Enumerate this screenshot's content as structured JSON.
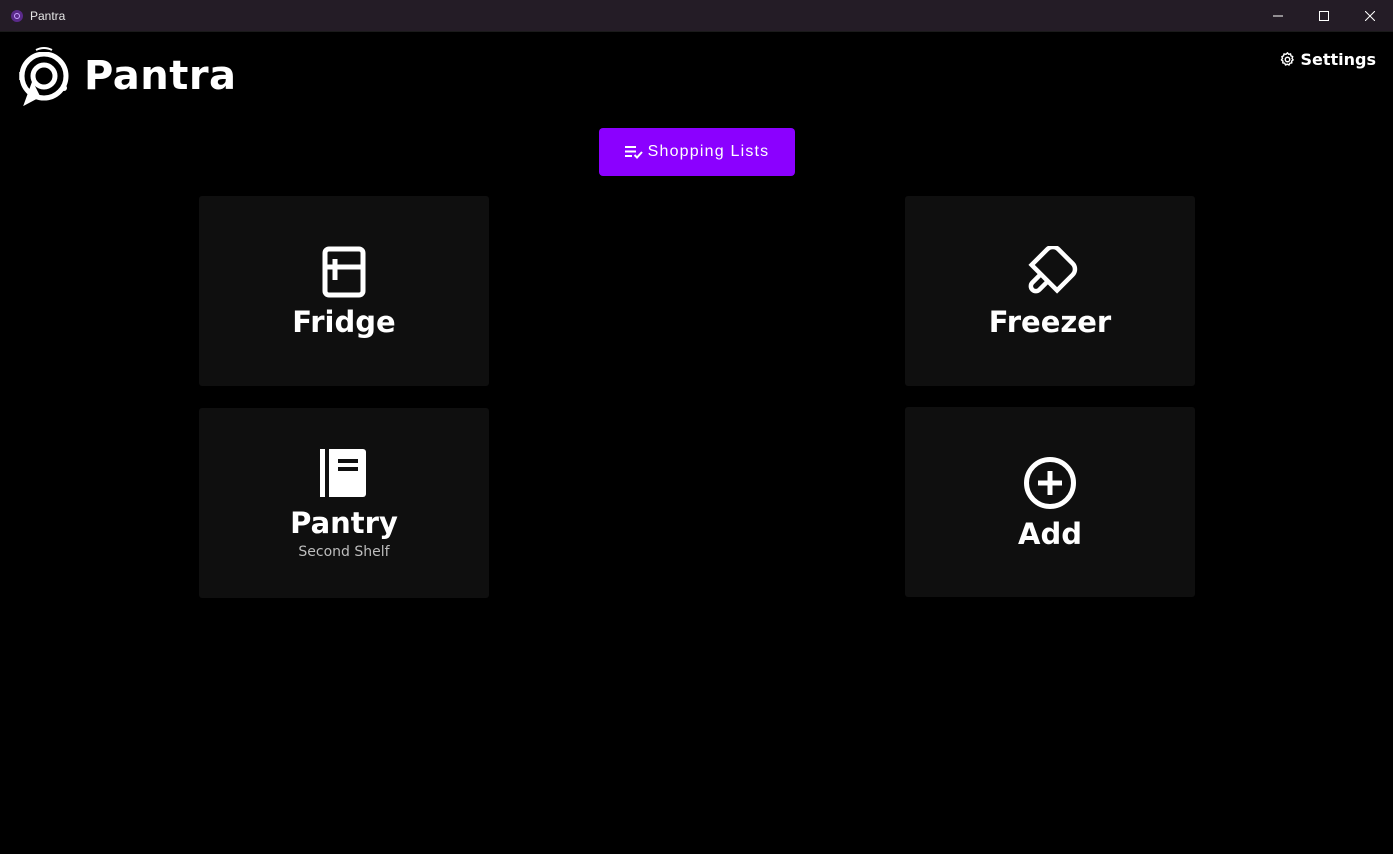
{
  "window": {
    "title": "Pantra",
    "controls": {
      "minimize": "minimize-icon",
      "maximize": "maximize-icon",
      "close": "close-icon"
    }
  },
  "header": {
    "logo_text": "Pantra",
    "settings_label": "Settings"
  },
  "shopping": {
    "label": "Shopping Lists"
  },
  "tiles": [
    {
      "label": "Fridge",
      "icon": "fridge-icon",
      "subtitle": ""
    },
    {
      "label": "Freezer",
      "icon": "popsicle-icon",
      "subtitle": ""
    },
    {
      "label": "Pantry",
      "icon": "book-icon",
      "subtitle": "Second Shelf"
    },
    {
      "label": "Add",
      "icon": "plus-circle-icon",
      "subtitle": ""
    }
  ],
  "colors": {
    "accent": "#8b00ff",
    "background": "#000000",
    "tile": "#0f0f0f",
    "titlebar": "#241c26"
  }
}
